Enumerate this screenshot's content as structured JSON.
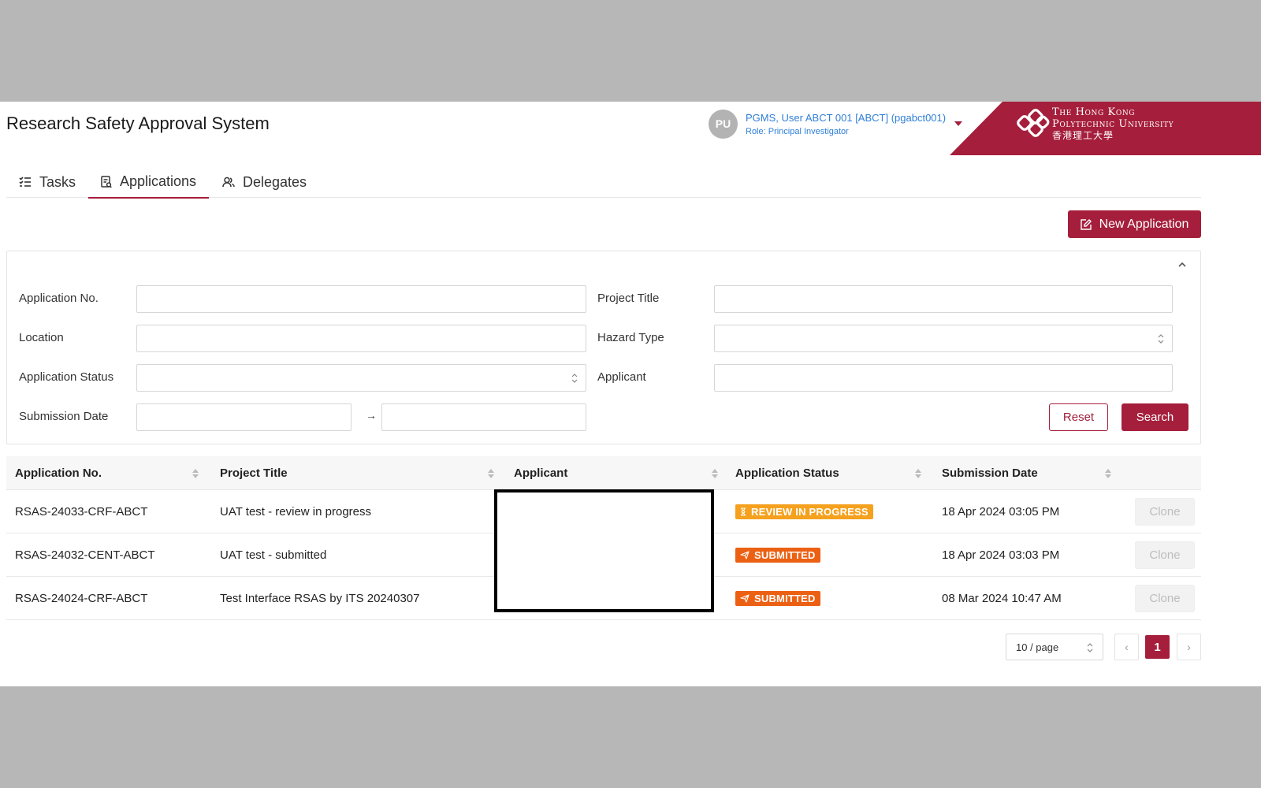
{
  "app": {
    "title": "Research Safety Approval System"
  },
  "user": {
    "initials": "PU",
    "name": "PGMS, User ABCT 001 [ABCT] (pgabct001)",
    "role": "Role: Principal Investigator"
  },
  "logo": {
    "line1": "The Hong Kong",
    "line2": "Polytechnic University",
    "chinese": "香港理工大學"
  },
  "tabs": [
    {
      "label": "Tasks",
      "icon": "task-list-icon",
      "active": false
    },
    {
      "label": "Applications",
      "icon": "document-icon",
      "active": true
    },
    {
      "label": "Delegates",
      "icon": "people-icon",
      "active": false
    }
  ],
  "actions": {
    "new_application": "New Application"
  },
  "filters": {
    "application_no": {
      "label": "Application No.",
      "value": ""
    },
    "project_title": {
      "label": "Project Title",
      "value": ""
    },
    "location": {
      "label": "Location",
      "value": ""
    },
    "hazard_type": {
      "label": "Hazard Type",
      "value": ""
    },
    "application_status": {
      "label": "Application Status",
      "value": ""
    },
    "applicant": {
      "label": "Applicant",
      "value": ""
    },
    "submission_date": {
      "label": "Submission Date",
      "from": "",
      "to": "",
      "separator": "→"
    },
    "reset_label": "Reset",
    "search_label": "Search"
  },
  "table": {
    "columns": [
      "Application No.",
      "Project Title",
      "Applicant",
      "Application Status",
      "Submission Date"
    ],
    "rows": [
      {
        "app_no": "RSAS-24033-CRF-ABCT",
        "title": "UAT test - review in progress",
        "applicant": "",
        "status": "REVIEW IN PROGRESS",
        "status_icon": "hourglass-icon",
        "date": "18 Apr 2024 03:05 PM",
        "action": "Clone"
      },
      {
        "app_no": "RSAS-24032-CENT-ABCT",
        "title": "UAT test - submitted",
        "applicant": "",
        "status": "SUBMITTED",
        "status_icon": "send-icon",
        "date": "18 Apr 2024 03:03 PM",
        "action": "Clone"
      },
      {
        "app_no": "RSAS-24024-CRF-ABCT",
        "title": "Test Interface RSAS by ITS 20240307",
        "applicant": "",
        "status": "SUBMITTED",
        "status_icon": "send-icon",
        "date": "08 Mar 2024 10:47 AM",
        "action": "Clone"
      }
    ]
  },
  "pagination": {
    "page_size": "10 / page",
    "current_page": "1",
    "prev": "‹",
    "next": "›"
  },
  "colors": {
    "brand": "#a51e3b",
    "link": "#2f7fd8",
    "review_badge": "#f5a11e",
    "submitted_badge": "#ec6013"
  }
}
